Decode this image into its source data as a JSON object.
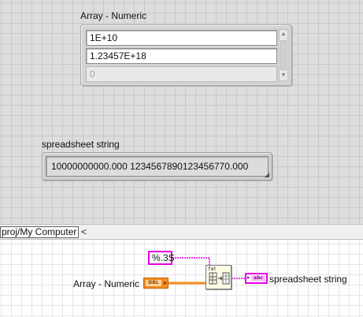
{
  "front_panel": {
    "array_control": {
      "label": "Array - Numeric",
      "elements": [
        "1E+10",
        "1.23457E+18",
        "0"
      ]
    },
    "string_indicator": {
      "label": "spreadsheet string",
      "value": "10000000000.000 1234567890123456770.000"
    }
  },
  "status_bar": {
    "context": "proj/My Computer",
    "scroll_left_glyph": "<"
  },
  "block_diagram": {
    "format_constant": "%.3S",
    "array_terminal_label": "Array - Numeric",
    "array_terminal_type": "DBL",
    "string_terminal_label": "spreadsheet string",
    "string_terminal_type": "abc",
    "function_glyph": "fmt"
  },
  "colors": {
    "numeric_wire": "#f58a1f",
    "string_wire": "#e600e6"
  }
}
